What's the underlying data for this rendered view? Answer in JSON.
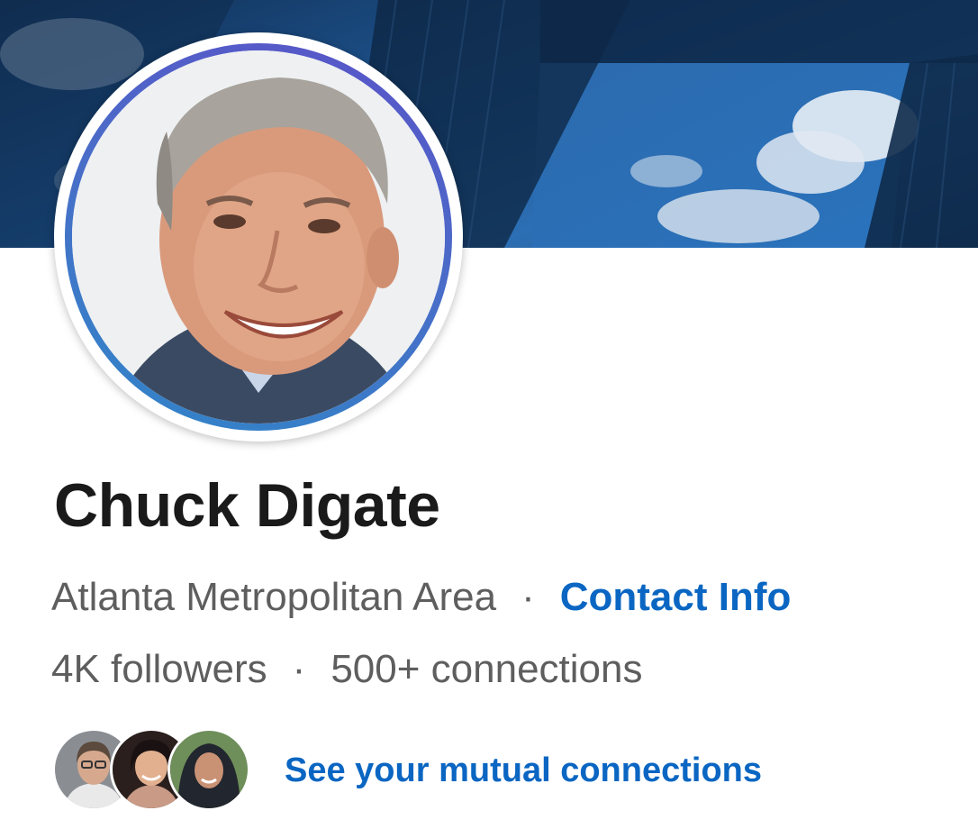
{
  "profile": {
    "name": "Chuck Digate",
    "location": "Atlanta Metropolitan Area",
    "separator": "·",
    "contact_info_label": "Contact Info",
    "followers": "4K followers",
    "connections": "500+ connections"
  },
  "mutual": {
    "label": "See your mutual connections",
    "avatars": [
      "mutual-avatar-1",
      "mutual-avatar-2",
      "mutual-avatar-3"
    ]
  },
  "colors": {
    "link": "#0a66c2",
    "name": "#1a1a1a",
    "meta": "#5e5e5e",
    "ring_start": "#5a52c8",
    "ring_end": "#2f86c8"
  }
}
